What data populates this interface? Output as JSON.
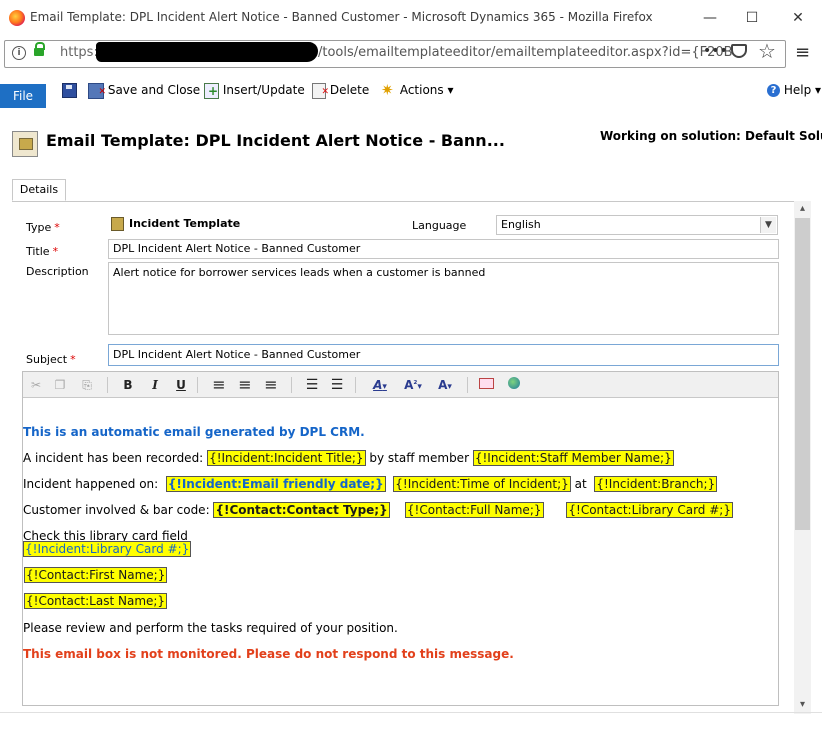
{
  "window": {
    "title": "Email Template: DPL Incident Alert Notice - Banned Customer - Microsoft Dynamics 365 - Mozilla Firefox",
    "min": "—",
    "max": "☐",
    "close": "✕"
  },
  "urlbar": {
    "protocol": "https://",
    "path": "/tools/emailtemplateeditor/emailtemplateeditor.aspx?id={F20B",
    "more": "•••",
    "star": "☆",
    "menu": "≡"
  },
  "ribbon": {
    "file": "File",
    "save_close": "Save and Close",
    "insert_update": "Insert/Update",
    "delete": "Delete",
    "actions": "Actions",
    "help": "Help",
    "caret": "▾"
  },
  "header": {
    "title": "Email Template: DPL Incident Alert Notice - Bann...",
    "solution": "Working on solution: Default Solution"
  },
  "tabs": {
    "details": "Details"
  },
  "form": {
    "type_label": "Type",
    "type_value": "Incident Template",
    "language_label": "Language",
    "language_value": "English",
    "title_label": "Title",
    "title_value": "DPL Incident Alert Notice - Banned Customer",
    "description_label": "Description",
    "description_value": "Alert notice for borrower services leads when a customer is banned",
    "subject_label": "Subject",
    "subject_value": "DPL Incident Alert Notice - Banned Customer",
    "required": "*"
  },
  "toolbar": {
    "cut": "✂",
    "copy": "❐",
    "paste": "⎘",
    "bold": "B",
    "italic": "I",
    "underline": "U",
    "align_left": "≡",
    "align_center": "≡",
    "align_right": "≡",
    "numbered": "☰",
    "bulleted": "☰",
    "font": "A",
    "font_size": "A",
    "font_color": "A",
    "caret": "▾",
    "sup": "²"
  },
  "body": {
    "intro": "This is an automatic email generated by DPL CRM.",
    "line1_text": "A incident has been recorded:",
    "line1_tag1": "{!Incident:Incident Title;}",
    "line1_mid": "by staff member",
    "line1_tag2": "{!Incident:Staff Member Name;}",
    "line2_text": "Incident happened on:",
    "line2_tag1": "{!Incident:Email friendly date;}",
    "line2_tag2": "{!Incident:Time of Incident;}",
    "line2_mid": "at",
    "line2_tag3": "{!Incident:Branch;}",
    "line3_text": "Customer involved & bar code:",
    "line3_tag1": "{!Contact:Contact Type;}",
    "line3_tag2": "{!Contact:Full Name;}",
    "line3_tag3": "{!Contact:Library Card #;}",
    "line4_text": "Check this library card field",
    "line4_tag": "{!Incident:Library Card #;}",
    "tag_first": "{!Contact:First Name;}",
    "tag_last": "{!Contact:Last Name;}",
    "review": "Please review and perform the tasks required of your position.",
    "warning": "This email box is not monitored. Please do not respond to this message."
  },
  "scroll": {
    "up": "▴",
    "down": "▾"
  }
}
